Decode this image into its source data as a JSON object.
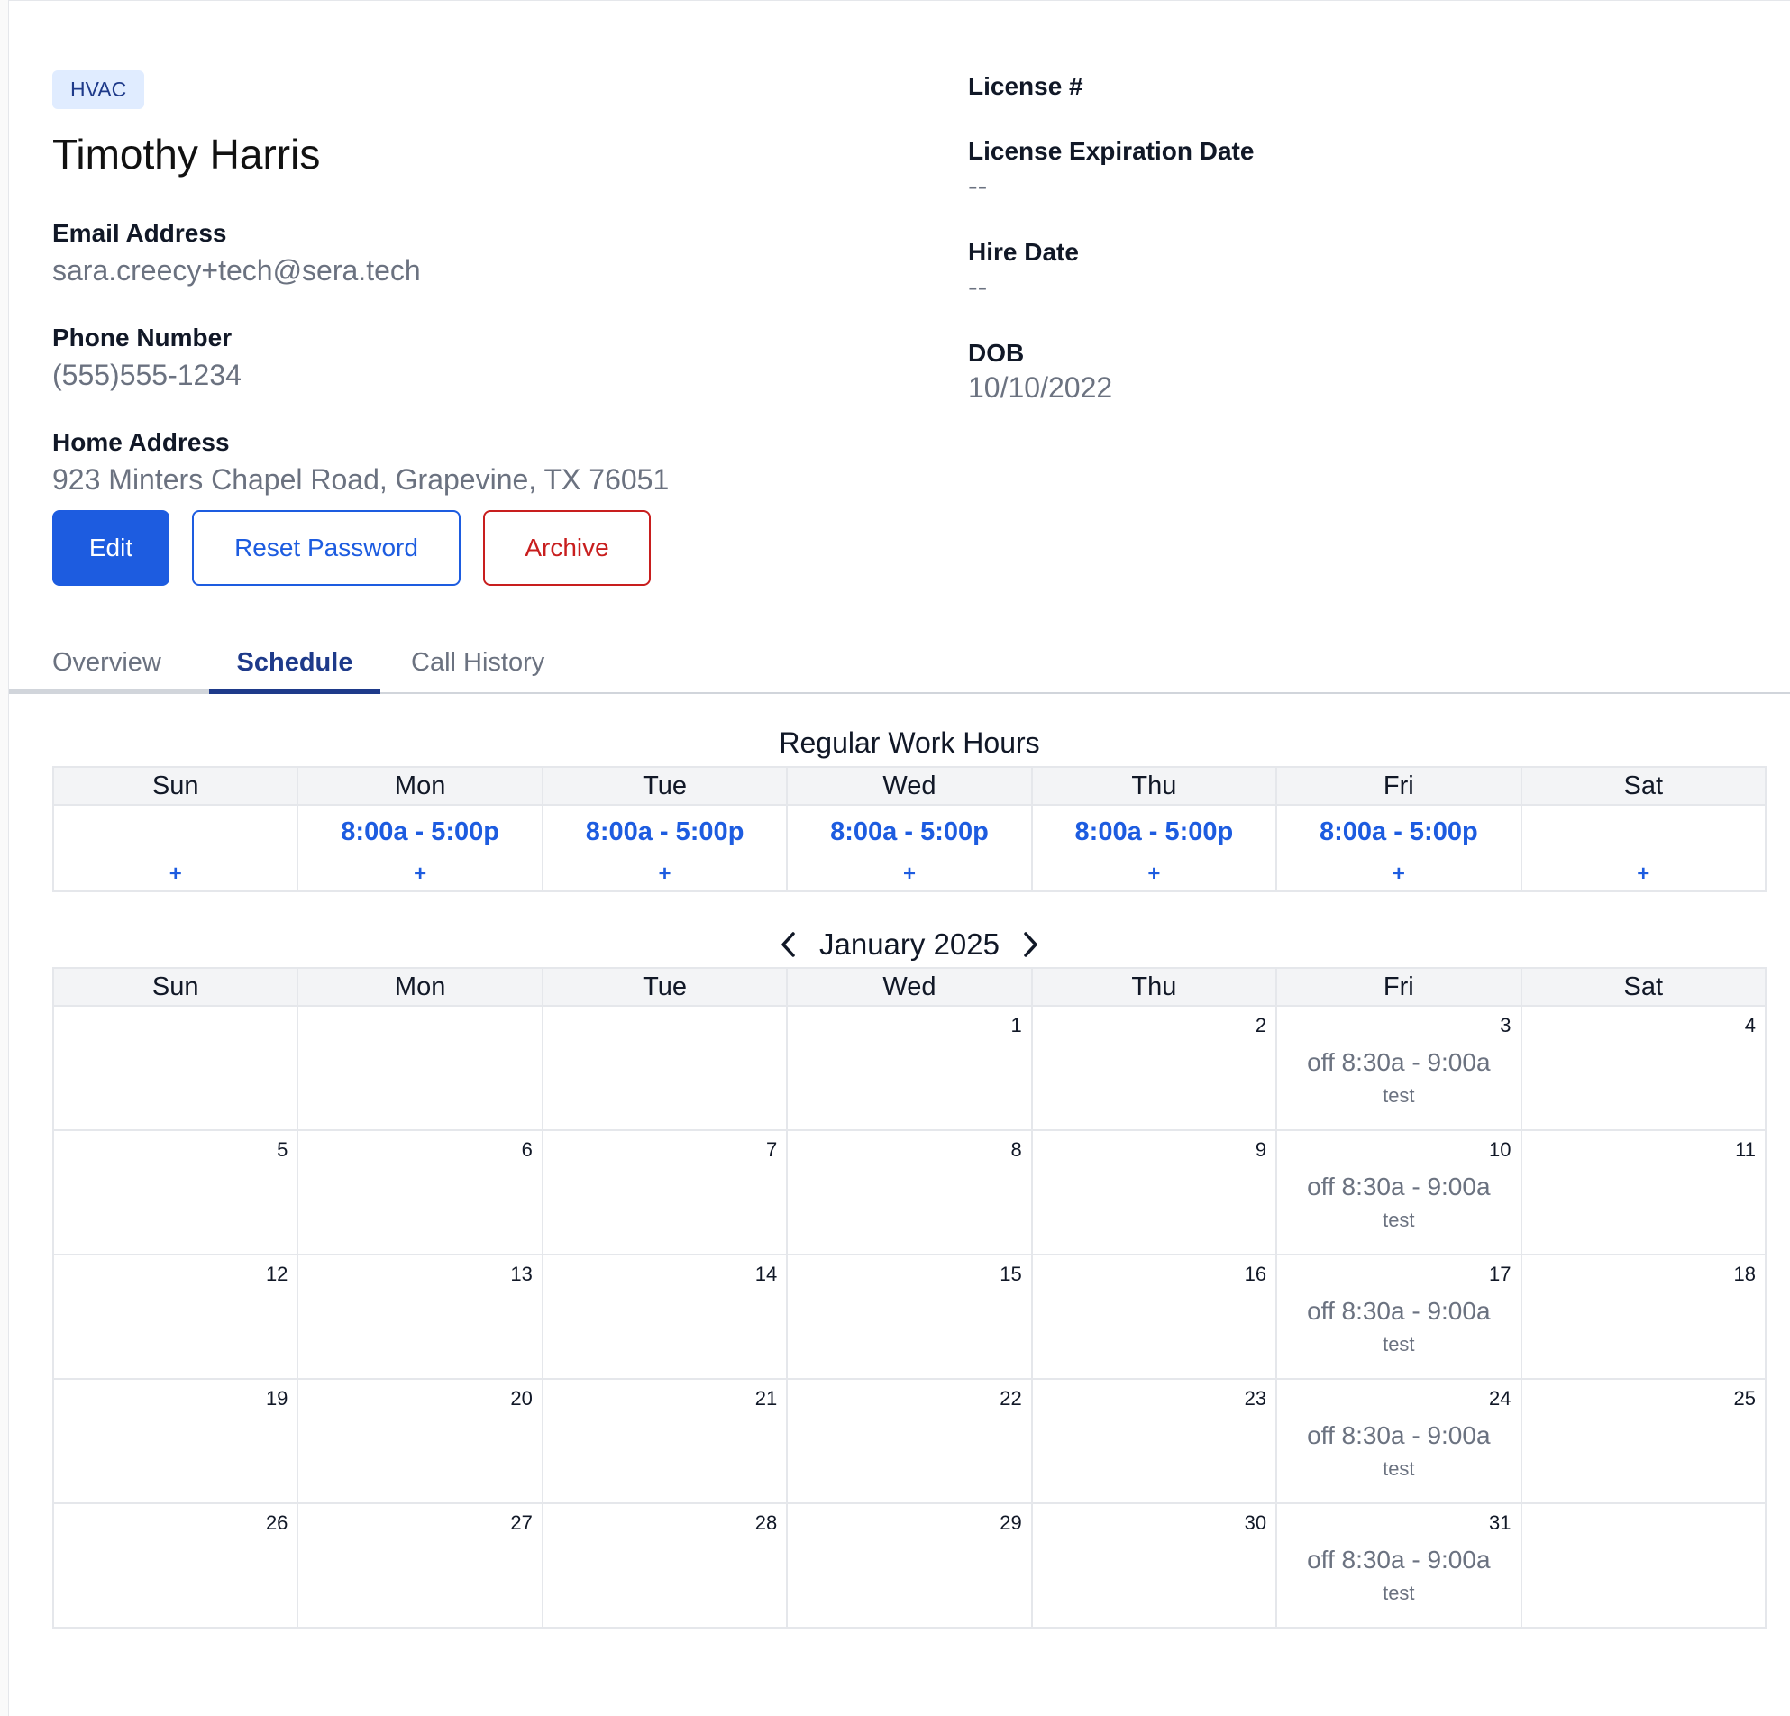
{
  "profile": {
    "badge": "HVAC",
    "name": "Timothy Harris",
    "fields": [
      {
        "label": "Email Address",
        "value": "sara.creecy+tech@sera.tech"
      },
      {
        "label": "Phone Number",
        "value": "(555)555-1234"
      },
      {
        "label": "Home Address",
        "value": "923 Minters Chapel Road, Grapevine, TX 76051"
      }
    ],
    "buttons": {
      "edit": "Edit",
      "reset_password": "Reset Password",
      "archive": "Archive"
    }
  },
  "details": [
    {
      "label": "License #",
      "value": ""
    },
    {
      "label": "License Expiration Date",
      "value": "--"
    },
    {
      "label": "Hire Date",
      "value": "--"
    },
    {
      "label": "DOB",
      "value": "10/10/2022"
    }
  ],
  "tabs": [
    "Overview",
    "Schedule",
    "Call History"
  ],
  "active_tab": "Schedule",
  "weekdays": [
    "Sun",
    "Mon",
    "Tue",
    "Wed",
    "Thu",
    "Fri",
    "Sat"
  ],
  "regular_hours": {
    "title": "Regular Work Hours",
    "hours": [
      "",
      "8:00a - 5:00p",
      "8:00a - 5:00p",
      "8:00a - 5:00p",
      "8:00a - 5:00p",
      "8:00a - 5:00p",
      ""
    ],
    "add_label": "+"
  },
  "calendar": {
    "title": "January 2025",
    "weeks": [
      [
        "",
        "",
        "",
        "1",
        "2",
        "3",
        "4"
      ],
      [
        "5",
        "6",
        "7",
        "8",
        "9",
        "10",
        "11"
      ],
      [
        "12",
        "13",
        "14",
        "15",
        "16",
        "17",
        "18"
      ],
      [
        "19",
        "20",
        "21",
        "22",
        "23",
        "24",
        "25"
      ],
      [
        "26",
        "27",
        "28",
        "29",
        "30",
        "31",
        ""
      ]
    ],
    "events": {
      "3": {
        "time": "off 8:30a - 9:00a",
        "note": "test"
      },
      "10": {
        "time": "off 8:30a - 9:00a",
        "note": "test"
      },
      "17": {
        "time": "off 8:30a - 9:00a",
        "note": "test"
      },
      "24": {
        "time": "off 8:30a - 9:00a",
        "note": "test"
      },
      "31": {
        "time": "off 8:30a - 9:00a",
        "note": "test"
      }
    }
  },
  "colors": {
    "primary": "#1d5ce0",
    "danger": "#c81e1e",
    "tab_active": "#1e3a8a",
    "badge_bg": "#e0ecff"
  }
}
